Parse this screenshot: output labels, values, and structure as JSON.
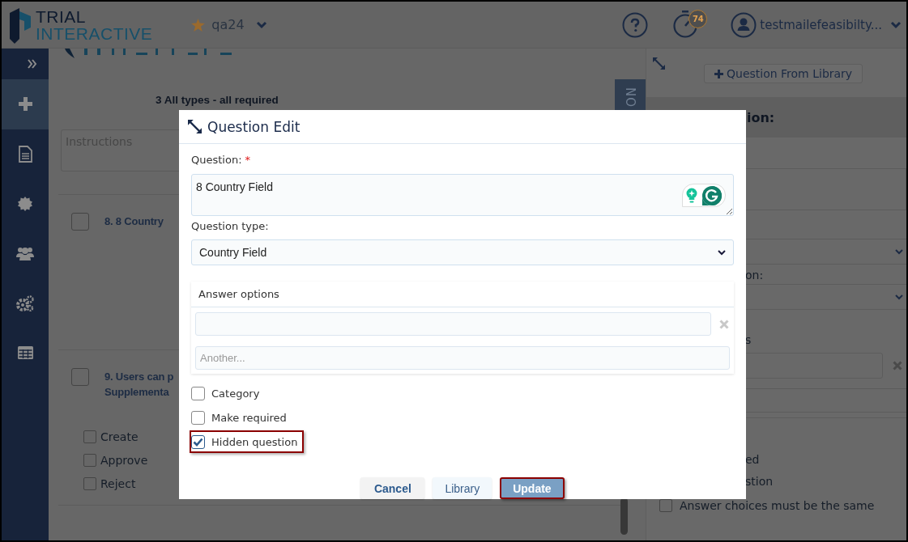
{
  "header": {
    "logo_top": "TRIAL",
    "logo_bottom": "INTERACTIVE",
    "project": "qa24",
    "timer_badge": "74",
    "user": "testmailefeasibilty..."
  },
  "sidebar": {
    "items": [
      {
        "kind": "expand",
        "selected": false
      },
      {
        "kind": "add",
        "selected": true
      },
      {
        "kind": "document",
        "selected": false
      },
      {
        "kind": "badge",
        "selected": false
      },
      {
        "kind": "users",
        "selected": false
      },
      {
        "kind": "cogs",
        "selected": false
      },
      {
        "kind": "table",
        "selected": false
      }
    ]
  },
  "main": {
    "survey_title": "3 All types - all required",
    "instructions_placeholder": "Instructions",
    "side_tab": "NO",
    "questions": [
      {
        "lines": [
          "8. 8 Country"
        ],
        "checked": false
      },
      {
        "lines": [
          "9. Users can p",
          "Supplementa"
        ],
        "checked": false,
        "options": [
          {
            "label": "Create",
            "checked": false
          },
          {
            "label": "Approve",
            "checked": false
          },
          {
            "label": "Reject",
            "checked": false
          }
        ]
      }
    ]
  },
  "right_panel": {
    "library_button": "Question From Library",
    "heading": "ion:",
    "label_1": "on:",
    "label_2": "s",
    "line_1": "ed",
    "line_2": "stion",
    "checkbox": {
      "label": "Answer choices must be the same",
      "checked": false
    }
  },
  "dialog": {
    "title": "Question Edit",
    "question_label": "Question:",
    "required_mark": "*",
    "question_value": "8 Country Field",
    "type_label": "Question type:",
    "type_value": "Country Field",
    "answer_options": {
      "title": "Answer options",
      "options": [
        {
          "removable": true
        }
      ],
      "new_placeholder": "Another..."
    },
    "checkboxes": [
      {
        "label": "Category",
        "checked": false,
        "highlighted": false
      },
      {
        "label": "Make required",
        "checked": false,
        "highlighted": false
      },
      {
        "label": "Hidden question",
        "checked": true,
        "highlighted": true
      }
    ],
    "buttons": [
      {
        "label": "Cancel",
        "kind": "default",
        "highlighted": false
      },
      {
        "label": "Library",
        "kind": "secondary",
        "highlighted": false
      },
      {
        "label": "Update",
        "kind": "primary",
        "highlighted": true
      }
    ]
  }
}
